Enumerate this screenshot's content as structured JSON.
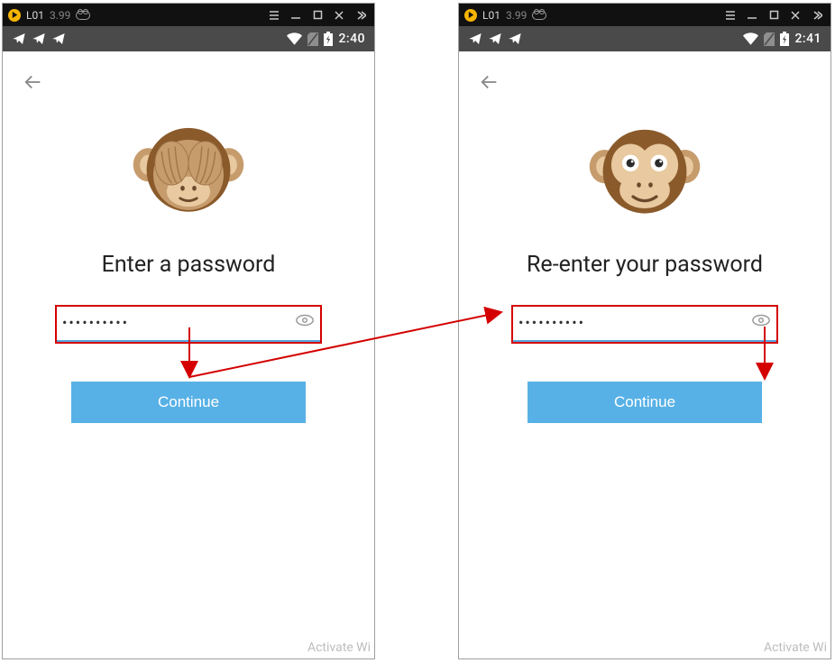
{
  "emulator": {
    "title": "L01",
    "version": "3.99"
  },
  "statusbar": {
    "time_left": "2:40",
    "time_right": "2:41"
  },
  "screens": {
    "left": {
      "title": "Enter a password",
      "password_value": "••••••••••",
      "button_label": "Continue"
    },
    "right": {
      "title": "Re-enter your password",
      "password_value": "••••••••••",
      "button_label": "Continue"
    }
  },
  "watermark": {
    "left": "Activate Wi",
    "right": "Activate Wi"
  }
}
